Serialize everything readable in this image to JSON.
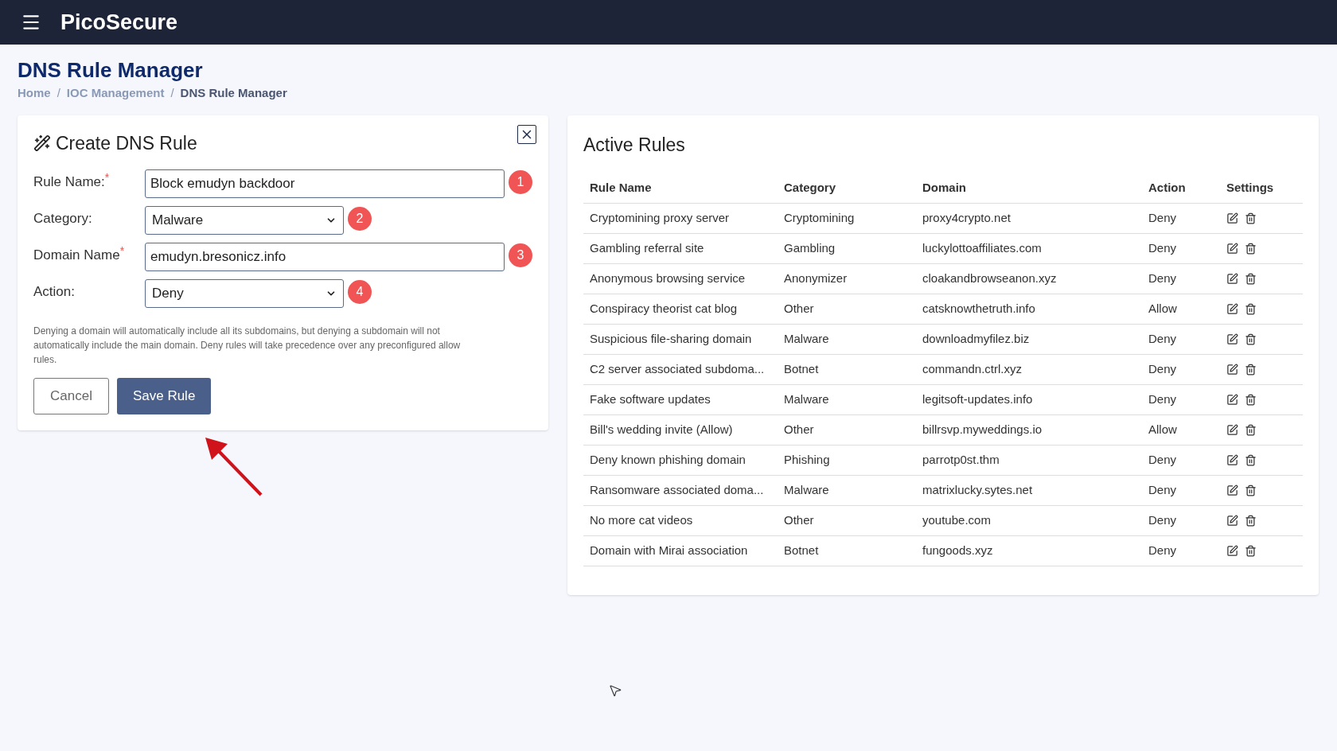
{
  "header": {
    "brand": "PicoSecure"
  },
  "page": {
    "title": "DNS Rule Manager",
    "breadcrumb": [
      {
        "kind": "link",
        "label": "Home",
        "current": false
      },
      {
        "kind": "separator",
        "label": "/"
      },
      {
        "kind": "link",
        "label": "IOC Management",
        "current": false
      },
      {
        "kind": "separator",
        "label": "/"
      },
      {
        "kind": "link",
        "label": "DNS Rule Manager",
        "current": true
      }
    ]
  },
  "create_form": {
    "title": "Create DNS Rule",
    "fields": [
      {
        "kind": "text",
        "label": "Rule Name:",
        "required_mark": "*",
        "value": "Block emudyn backdoor",
        "marker": "1"
      },
      {
        "kind": "select",
        "label": "Category:",
        "value": "Malware",
        "marker": "2"
      },
      {
        "kind": "text",
        "label": "Domain Name",
        "required_mark": "*",
        "value": "emudyn.bresonicz.info",
        "marker": "3"
      },
      {
        "kind": "select",
        "label": "Action:",
        "value": "Deny",
        "marker": "4"
      }
    ],
    "note": "Denying a domain will automatically include all its subdomains, but denying a subdomain will not automatically include the main domain. Deny rules will take precedence over any preconfigured allow rules.",
    "buttons": [
      {
        "kind": "secondary",
        "label": "Cancel"
      },
      {
        "kind": "primary",
        "label": "Save Rule"
      }
    ]
  },
  "active_rules": {
    "title": "Active Rules",
    "columns": [
      "Rule Name",
      "Category",
      "Domain",
      "Action",
      "Settings"
    ],
    "rows": [
      {
        "rule_name": "Cryptomining proxy server",
        "category": "Cryptomining",
        "domain": "proxy4crypto.net",
        "action": "Deny"
      },
      {
        "rule_name": "Gambling referral site",
        "category": "Gambling",
        "domain": "luckylottoaffiliates.com",
        "action": "Deny"
      },
      {
        "rule_name": "Anonymous browsing service",
        "category": "Anonymizer",
        "domain": "cloakandbrowseanon.xyz",
        "action": "Deny"
      },
      {
        "rule_name": "Conspiracy theorist cat blog",
        "category": "Other",
        "domain": "catsknowthetruth.info",
        "action": "Allow"
      },
      {
        "rule_name": "Suspicious file-sharing domain",
        "category": "Malware",
        "domain": "downloadmyfilez.biz",
        "action": "Deny"
      },
      {
        "rule_name": "C2 server associated subdoma...",
        "category": "Botnet",
        "domain": "commandn.ctrl.xyz",
        "action": "Deny"
      },
      {
        "rule_name": "Fake software updates",
        "category": "Malware",
        "domain": "legitsoft-updates.info",
        "action": "Deny"
      },
      {
        "rule_name": "Bill's wedding invite (Allow)",
        "category": "Other",
        "domain": "billrsvp.myweddings.io",
        "action": "Allow"
      },
      {
        "rule_name": "Deny known phishing domain",
        "category": "Phishing",
        "domain": "parrotp0st.thm",
        "action": "Deny"
      },
      {
        "rule_name": "Ransomware associated doma...",
        "category": "Malware",
        "domain": "matrixlucky.sytes.net",
        "action": "Deny"
      },
      {
        "rule_name": "No more cat videos",
        "category": "Other",
        "domain": "youtube.com",
        "action": "Deny"
      },
      {
        "rule_name": "Domain with Mirai association",
        "category": "Botnet",
        "domain": "fungoods.xyz",
        "action": "Deny"
      }
    ]
  }
}
